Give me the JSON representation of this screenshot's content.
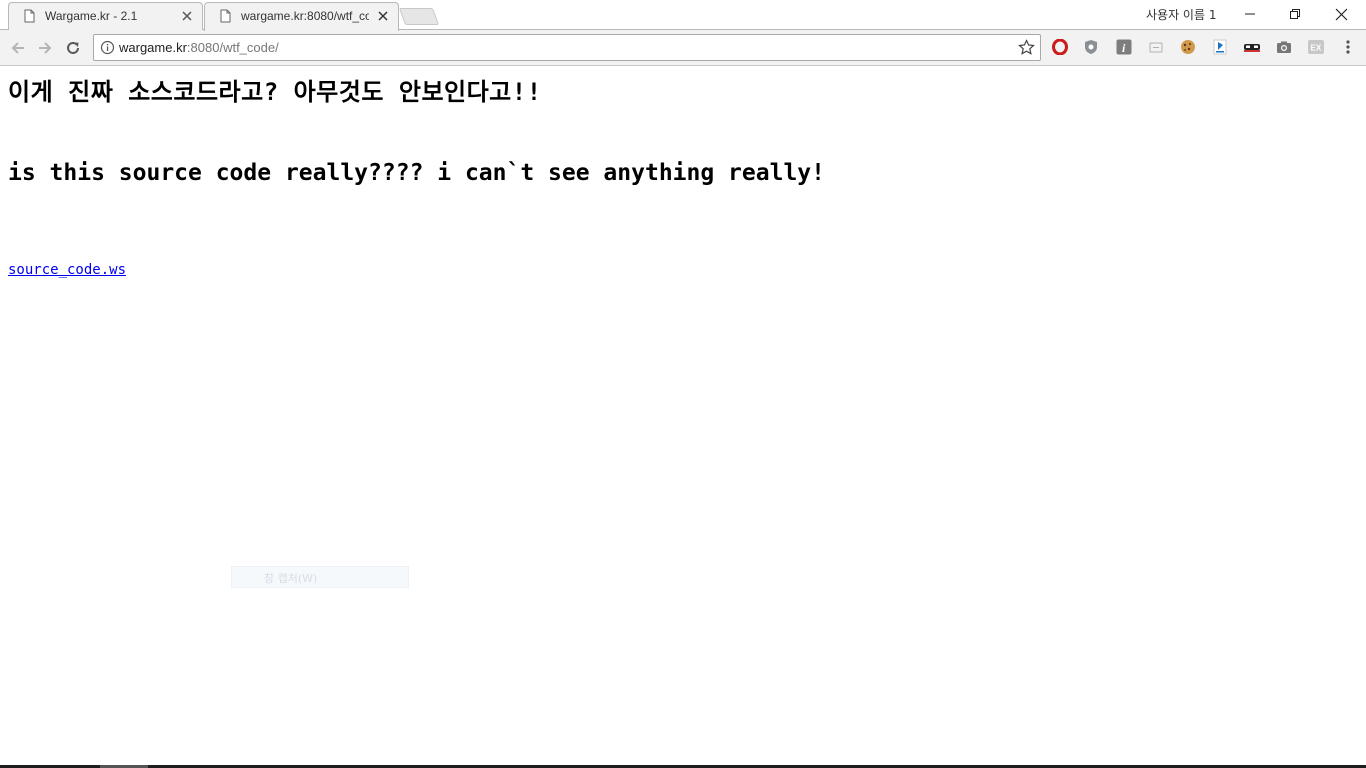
{
  "browser": {
    "tabs": [
      {
        "title": "Wargame.kr - 2.1",
        "active": false
      },
      {
        "title": "wargame.kr:8080/wtf_co",
        "active": true
      }
    ],
    "profile_name": "사용자 이름 1",
    "address": {
      "host": "wargame.kr",
      "path": ":8080/wtf_code/"
    },
    "extensions": [
      "opera-icon",
      "shield-icon",
      "info-italic-icon",
      "reader-icon",
      "cookie-icon",
      "bookmark-blue-icon",
      "mask-icon",
      "camera-icon",
      "ex-icon",
      "menu-dots-icon"
    ]
  },
  "page": {
    "heading_ko": "이게 진짜 소스코드라고? 아무것도 안보인다고!!",
    "heading_en": "is this source code really???? i can`t see anything really!",
    "link_text": "source_code.ws",
    "ghost_menu_label": "창 캡처(W)"
  },
  "colors": {
    "link": "#0000ee",
    "toolbar_bg": "#f2f2f2",
    "opera_red": "#cc1b1b"
  }
}
